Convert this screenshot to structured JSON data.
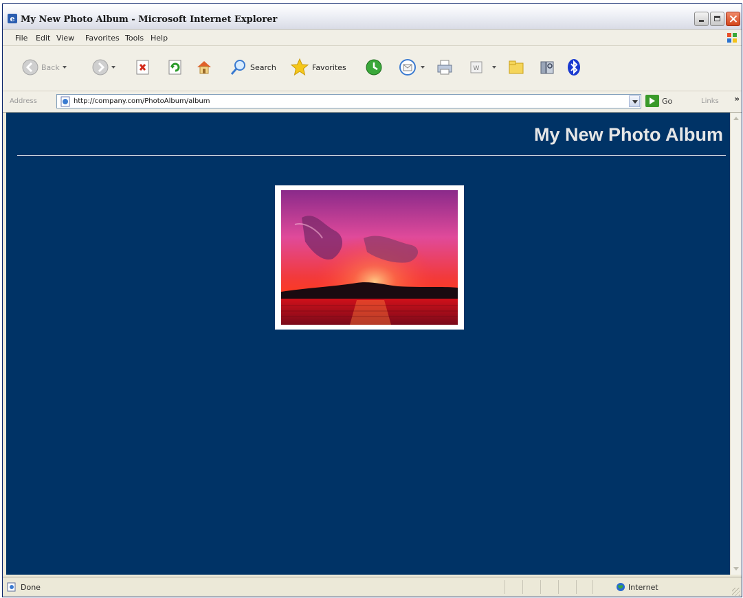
{
  "window": {
    "title": "My New Photo Album - Microsoft Internet Explorer"
  },
  "menu": {
    "items": [
      "File",
      "Edit",
      "View",
      "Favorites",
      "Tools",
      "Help"
    ]
  },
  "toolbar": {
    "back_label": "Back",
    "search_label": "Search",
    "favorites_label": "Favorites"
  },
  "address_bar": {
    "label": "Address",
    "url": "http://company.com/PhotoAlbum/album",
    "go_label": "Go",
    "links_label": "Links",
    "more_label": "»"
  },
  "page": {
    "background": "#003366",
    "title": "My New Photo Album",
    "photo_subject": "sunset over water"
  },
  "status_bar": {
    "status": "Done",
    "zone": "Internet"
  }
}
